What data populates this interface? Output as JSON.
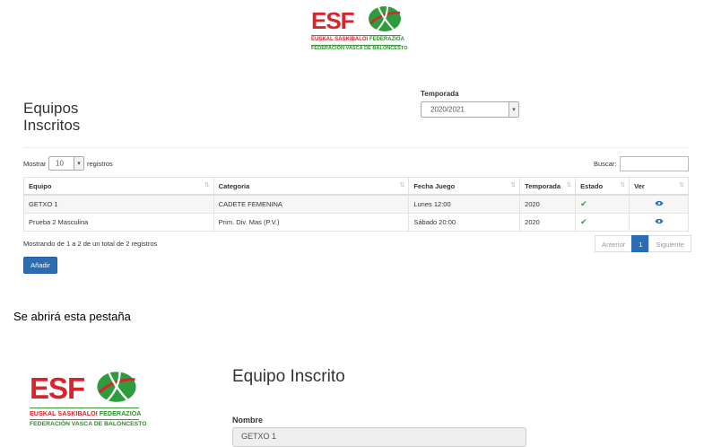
{
  "logo": {
    "letters": "ESF",
    "line1_red": "EUSKAL SASKIBALOI",
    "line1_green": "FEDERAZIOA",
    "line2": "FEDERACIÓN VASCA DE BALONCESTO"
  },
  "page_title_line1": "Equipos",
  "page_title_line2": "Inscritos",
  "season": {
    "label": "Temporada",
    "selected": "2020/2021"
  },
  "length_control": {
    "prefix": "Mostrar",
    "value": "10",
    "suffix": "registros"
  },
  "search": {
    "label": "Buscar:",
    "value": ""
  },
  "table": {
    "columns": [
      "Equipo",
      "Categoria",
      "Fecha Juego",
      "Temporada",
      "Estado",
      "Ver"
    ],
    "rows": [
      {
        "equipo": "GETXO 1",
        "categoria": "CADETE FEMENINA",
        "fecha": "Lunes 12:00",
        "temporada": "2020"
      },
      {
        "equipo": "Prueba 2 Masculina",
        "categoria": "Prim. Div. Mas (P.V.)",
        "fecha": "Sábado 20:00",
        "temporada": "2020"
      }
    ]
  },
  "info_text": "Mostrando de 1 a 2 de un total de 2 registros",
  "pagination": {
    "prev": "Anterior",
    "page": "1",
    "next": "Siguiente"
  },
  "add_button": "Añadir",
  "caption": "Se abrirá esta pestaña",
  "detail": {
    "title": "Equipo Inscrito",
    "nombre_label": "Nombre",
    "nombre_value": "GETXO 1"
  },
  "colors": {
    "red": "#d9232d",
    "green": "#2e8b2e",
    "primary": "#2a6db2",
    "check": "#2e9b3c"
  }
}
